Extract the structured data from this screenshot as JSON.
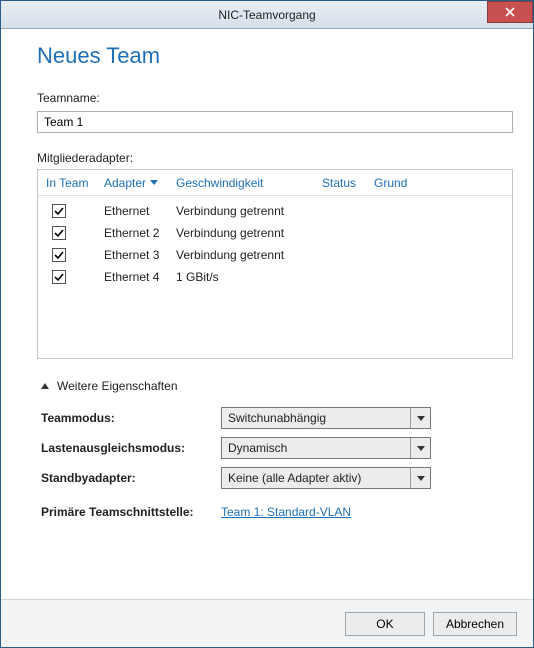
{
  "window": {
    "title": "NIC-Teamvorgang"
  },
  "page": {
    "title": "Neues Team"
  },
  "teamname": {
    "label": "Teamname:",
    "value": "Team 1"
  },
  "members": {
    "label": "Mitgliederadapter:",
    "columns": {
      "inteam": "In Team",
      "adapter": "Adapter",
      "speed": "Geschwindigkeit",
      "status": "Status",
      "reason": "Grund"
    },
    "rows": [
      {
        "checked": true,
        "adapter": "Ethernet",
        "speed": "Verbindung getrennt"
      },
      {
        "checked": true,
        "adapter": "Ethernet 2",
        "speed": "Verbindung getrennt"
      },
      {
        "checked": true,
        "adapter": "Ethernet 3",
        "speed": "Verbindung getrennt"
      },
      {
        "checked": true,
        "adapter": "Ethernet 4",
        "speed": "1 GBit/s"
      }
    ]
  },
  "expander": {
    "label": "Weitere Eigenschaften"
  },
  "properties": {
    "teammode": {
      "label": "Teammodus:",
      "value": "Switchunabhängig"
    },
    "loadbal": {
      "label": "Lastenausgleichsmodus:",
      "value": "Dynamisch"
    },
    "standby": {
      "label": "Standbyadapter:",
      "value": "Keine (alle Adapter aktiv)"
    },
    "primaryif": {
      "label": "Primäre Teamschnittstelle:",
      "link": "Team 1: Standard-VLAN"
    }
  },
  "footer": {
    "ok": "OK",
    "cancel": "Abbrechen"
  }
}
